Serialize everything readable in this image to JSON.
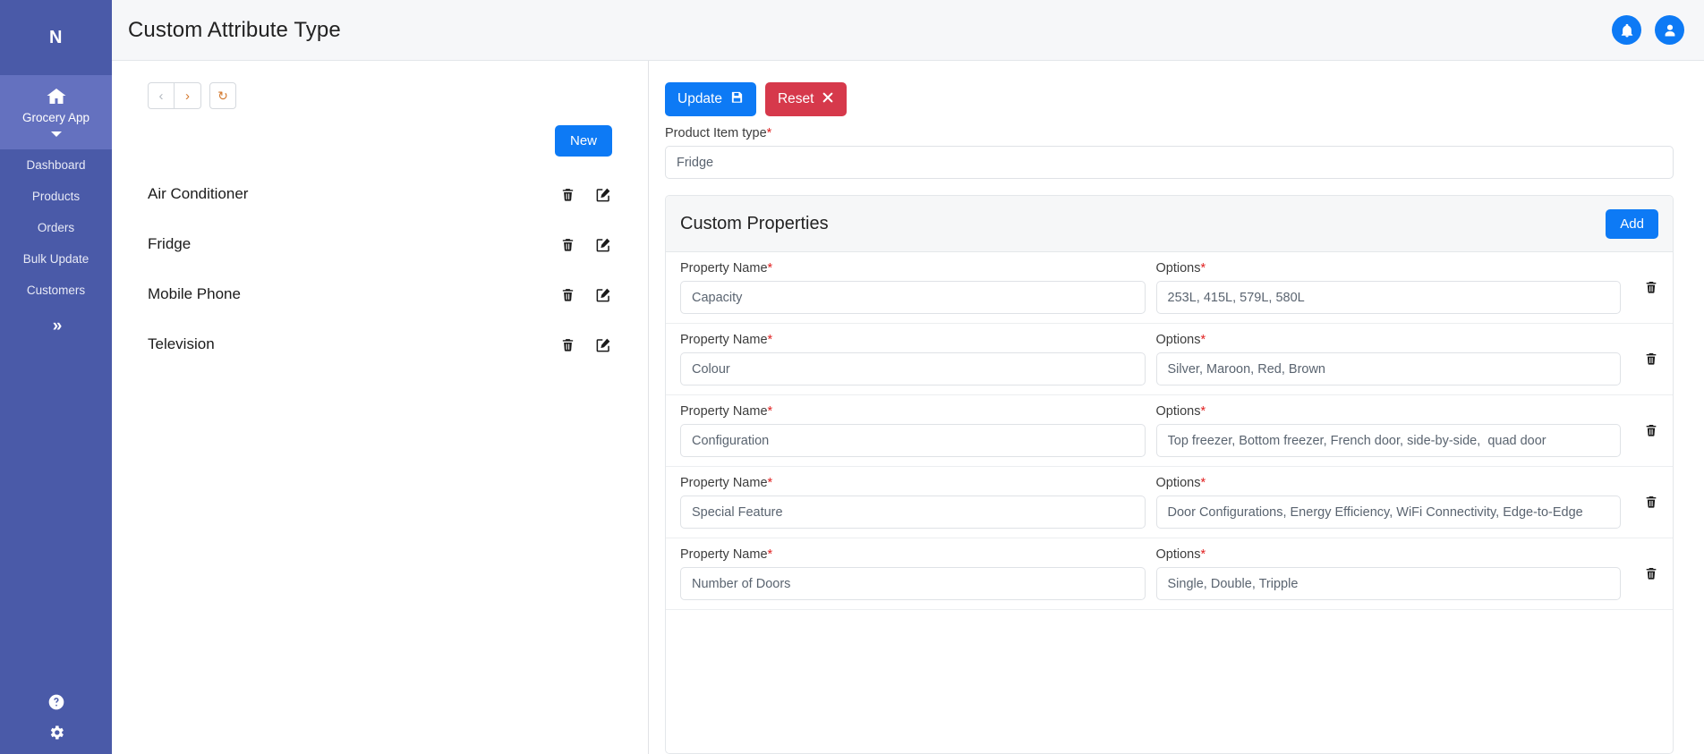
{
  "sidebar": {
    "logo": "N",
    "app": {
      "label": "Grocery App",
      "icon": "home-icon",
      "caret": "chevron-down-icon"
    },
    "items": [
      {
        "label": "Dashboard"
      },
      {
        "label": "Products"
      },
      {
        "label": "Orders"
      },
      {
        "label": "Bulk Update"
      },
      {
        "label": "Customers"
      }
    ],
    "expand_icon": "»",
    "bottom_icons": [
      {
        "name": "help-icon"
      },
      {
        "name": "settings-gear-icon"
      }
    ],
    "colors": {
      "bg": "#4a5aa8",
      "active": "#6471bf"
    }
  },
  "header": {
    "title": "Custom Attribute Type",
    "notification_icon": "bell-icon",
    "account_icon": "user-avatar-icon",
    "accent": "#0d7af5"
  },
  "toolbar": {
    "back_label": "‹",
    "forward_label": "›",
    "refresh_label": "↻"
  },
  "list_pane": {
    "new_label": "New",
    "items": [
      {
        "name": "Air Conditioner"
      },
      {
        "name": "Fridge"
      },
      {
        "name": "Mobile Phone"
      },
      {
        "name": "Television"
      }
    ]
  },
  "form": {
    "update_label": "Update",
    "reset_label": "Reset",
    "product_item_type_label": "Product Item type",
    "required_mark": "*",
    "product_item_type_value": "Fridge",
    "custom_properties_title": "Custom Properties",
    "add_label": "Add",
    "property_name_label": "Property Name",
    "options_label": "Options",
    "properties": [
      {
        "name": "Capacity",
        "options": "253L, 415L, 579L, 580L"
      },
      {
        "name": "Colour",
        "options": "Silver, Maroon, Red, Brown"
      },
      {
        "name": "Configuration",
        "options": "Top freezer, Bottom freezer, French door, side-by-side,  quad door"
      },
      {
        "name": "Special Feature",
        "options": "Door Configurations, Energy Efficiency, WiFi Connectivity, Edge-to-Edge"
      },
      {
        "name": "Number of Doors",
        "options": "Single, Double, Tripple"
      }
    ]
  }
}
